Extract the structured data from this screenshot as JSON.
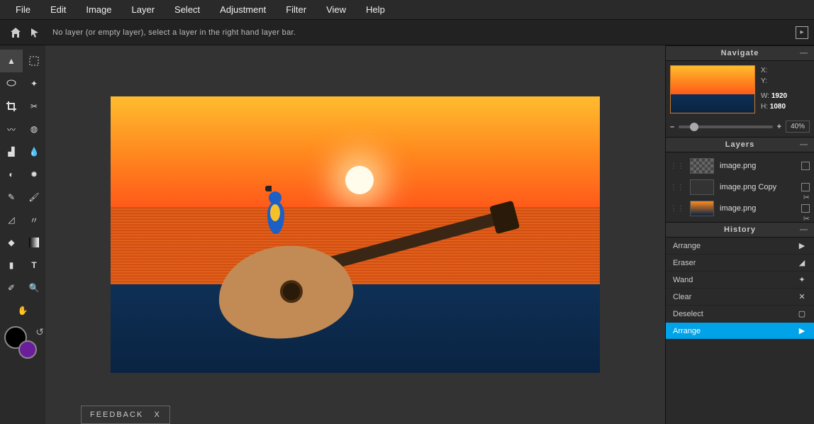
{
  "menu": {
    "file": "File",
    "edit": "Edit",
    "image": "Image",
    "layer": "Layer",
    "select": "Select",
    "adjustment": "Adjustment",
    "filter": "Filter",
    "view": "View",
    "help": "Help"
  },
  "status": {
    "message": "No layer (or empty layer), select a layer in the right hand layer bar."
  },
  "feedback": {
    "label": "FEEDBACK",
    "close": "X"
  },
  "colors": {
    "primary": "#000000",
    "secondary": "#6a1e9a"
  },
  "panels": {
    "navigate": {
      "title": "Navigate",
      "xLabel": "X:",
      "yLabel": "Y:",
      "wLabel": "W:",
      "hLabel": "H:",
      "w": "1920",
      "h": "1080",
      "zoom": "40%"
    },
    "layers": {
      "title": "Layers",
      "items": [
        {
          "name": "image.png"
        },
        {
          "name": "image.png Copy"
        },
        {
          "name": "image.png"
        }
      ]
    },
    "history": {
      "title": "History",
      "items": [
        {
          "label": "Arrange",
          "icon": "▶"
        },
        {
          "label": "Eraser",
          "icon": "◢"
        },
        {
          "label": "Wand",
          "icon": "✦"
        },
        {
          "label": "Clear",
          "icon": "✕"
        },
        {
          "label": "Deselect",
          "icon": "▢"
        },
        {
          "label": "Arrange",
          "icon": "▶",
          "active": true
        }
      ]
    }
  }
}
